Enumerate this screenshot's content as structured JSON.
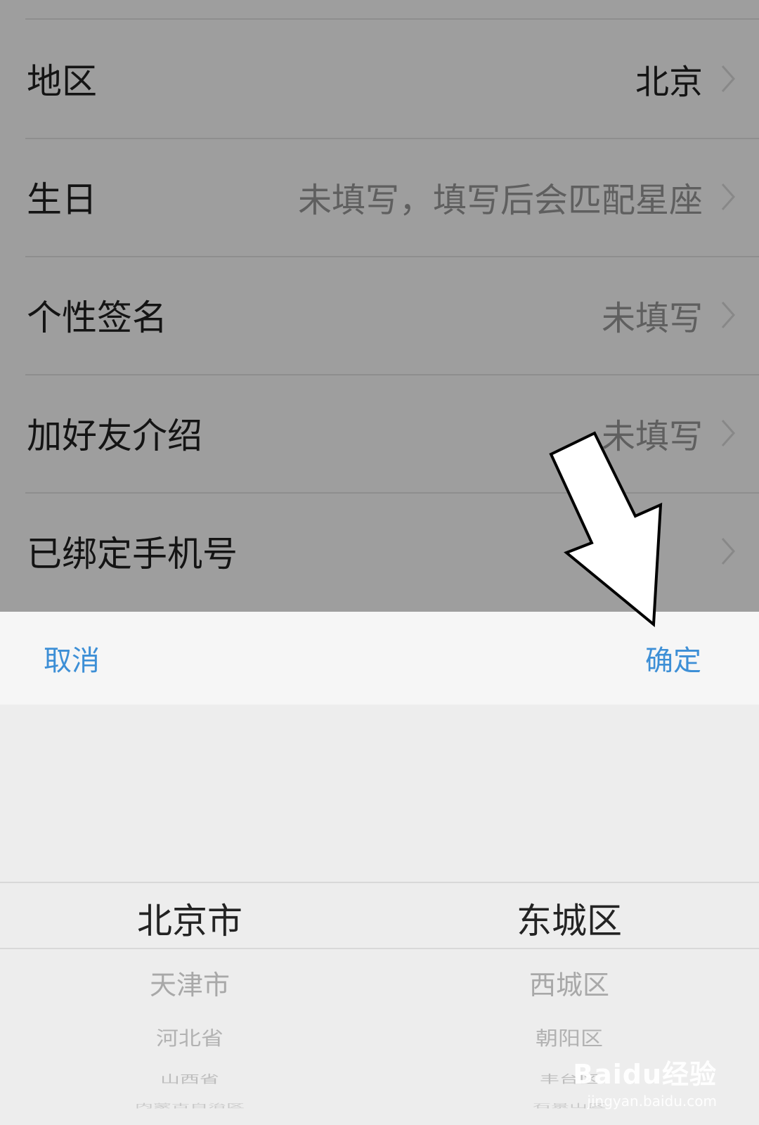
{
  "settings_rows": [
    {
      "label": "地区",
      "value": "北京"
    },
    {
      "label": "生日",
      "value": "未填写，填写后会匹配星座"
    },
    {
      "label": "个性签名",
      "value": "未填写"
    },
    {
      "label": "加好友介绍",
      "value": "未填写"
    },
    {
      "label": "已绑定手机号",
      "value": ""
    }
  ],
  "sheet": {
    "cancel_label": "取消",
    "confirm_label": "确定"
  },
  "picker": {
    "province": {
      "selected": "北京市",
      "options": [
        "天津市",
        "河北省",
        "山西省",
        "内蒙古自治区"
      ]
    },
    "district": {
      "selected": "东城区",
      "options": [
        "西城区",
        "朝阳区",
        "丰台区",
        "石景山区"
      ]
    }
  },
  "watermark": {
    "brand": "Baidu经验",
    "url": "jingyan.baidu.com"
  },
  "colors": {
    "accent": "#3d8fd6",
    "overlay": "#9e9e9e"
  },
  "icons": {
    "chevron": "chevron-right-icon",
    "annotation": "arrow-annotation"
  }
}
